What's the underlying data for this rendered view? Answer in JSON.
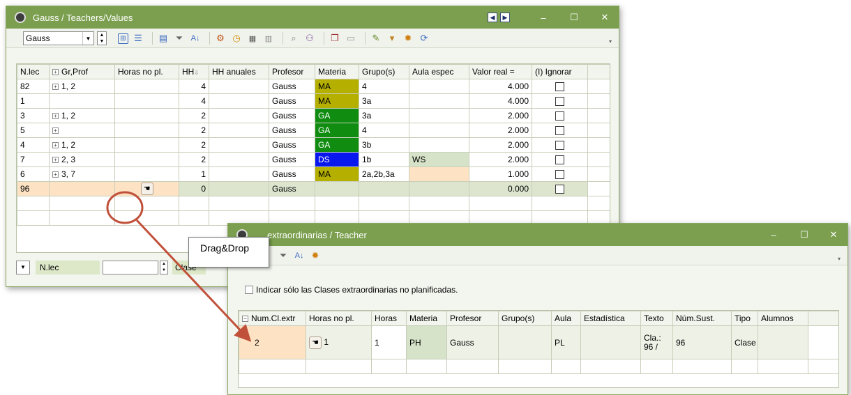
{
  "window1": {
    "title": "Gauss / Teachers/Values",
    "combo_value": "Gauss",
    "columns": [
      "N.lec",
      "Gr,Prof",
      "Horas no pl.",
      "HH",
      "HH anuales",
      "Profesor",
      "Materia",
      "Grupo(s)",
      "Aula espec",
      "Valor real =",
      "(I) Ignorar"
    ],
    "rows": [
      {
        "nlec": "82",
        "grprof": "1, 2",
        "horasnopl": "",
        "hh": "4",
        "hhanuales": "",
        "profesor": "Gauss",
        "materia": "MA",
        "grupos": "4",
        "aulaespec": "",
        "valorreal": "4.000"
      },
      {
        "nlec": "1",
        "grprof": "",
        "horasnopl": "",
        "hh": "4",
        "hhanuales": "",
        "profesor": "Gauss",
        "materia": "MA",
        "grupos": "3a",
        "aulaespec": "",
        "valorreal": "4.000"
      },
      {
        "nlec": "3",
        "grprof": "1, 2",
        "horasnopl": "",
        "hh": "2",
        "hhanuales": "",
        "profesor": "Gauss",
        "materia": "GA",
        "grupos": "3a",
        "aulaespec": "",
        "valorreal": "2.000"
      },
      {
        "nlec": "5",
        "grprof": "",
        "horasnopl": "",
        "hh": "2",
        "hhanuales": "",
        "profesor": "Gauss",
        "materia": "GA",
        "grupos": "4",
        "aulaespec": "",
        "valorreal": "2.000"
      },
      {
        "nlec": "4",
        "grprof": "1, 2",
        "horasnopl": "",
        "hh": "2",
        "hhanuales": "",
        "profesor": "Gauss",
        "materia": "GA",
        "grupos": "3b",
        "aulaespec": "",
        "valorreal": "2.000"
      },
      {
        "nlec": "7",
        "grprof": "2, 3",
        "horasnopl": "",
        "hh": "2",
        "hhanuales": "",
        "profesor": "Gauss",
        "materia": "DS",
        "grupos": "1b",
        "aulaespec": "WS",
        "valorreal": "2.000"
      },
      {
        "nlec": "6",
        "grprof": "3, 7",
        "horasnopl": "",
        "hh": "1",
        "hhanuales": "",
        "profesor": "Gauss",
        "materia": "MA",
        "grupos": "2a,2b,3a",
        "aulaespec": "",
        "valorreal": "1.000"
      },
      {
        "nlec": "96",
        "grprof": "",
        "horasnopl": "",
        "hh": "0",
        "hhanuales": "",
        "profesor": "Gauss",
        "materia": "",
        "grupos": "",
        "aulaespec": "",
        "valorreal": "0.000"
      }
    ],
    "footer_filter_label": "N.lec",
    "footer_right_label": "Clase"
  },
  "window2": {
    "title": "extraordinarias / Teacher",
    "checkbox_label": "Indicar sólo las Clases extraordinarias no planificadas.",
    "columns": [
      "Num.Cl.extr",
      "Horas no pl.",
      "Horas",
      "Materia",
      "Profesor",
      "Grupo(s)",
      "Aula",
      "Estadística",
      "Texto",
      "Núm.Sust.",
      "Tipo",
      "Alumnos"
    ],
    "row": {
      "num": "2",
      "horasnopl": "1",
      "horas": "1",
      "materia": "PH",
      "profesor": "Gauss",
      "grupos": "",
      "aula": "PL",
      "estadistica": "",
      "texto1": "Cla.:",
      "texto2": "96 /",
      "numsust": "96",
      "tipo": "Clase",
      "alumnos": ""
    }
  },
  "callout": "Drag&Drop",
  "colors": {
    "titlebar": "#7b9f4f",
    "MA": "#b5b000",
    "GA": "#108c10",
    "DS": "#0a18f0",
    "highlight": "#fde3c4",
    "annotation": "#c0503a"
  },
  "icons": [
    "clock-icon",
    "expand-icon",
    "list-icon",
    "report-icon",
    "filter-icon",
    "sort-icon",
    "settings-gear-icon",
    "refresh-icon",
    "hand-drag-icon"
  ]
}
